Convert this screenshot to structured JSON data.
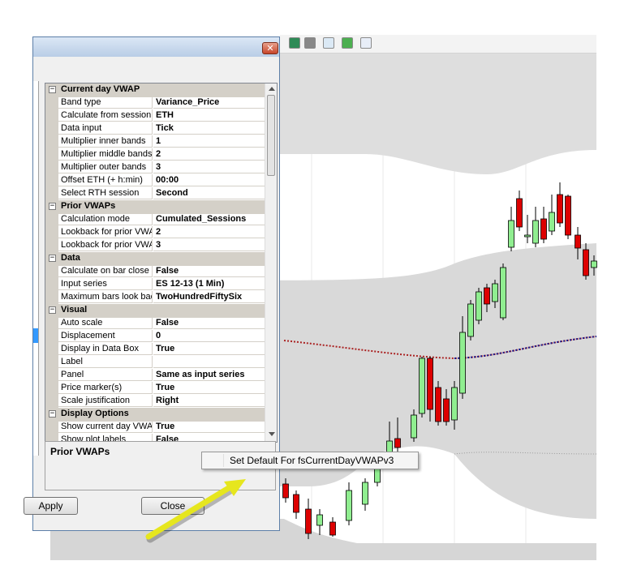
{
  "window": {
    "close_glyph": "✕"
  },
  "property_grid": {
    "sections": [
      {
        "title": "Current day VWAP",
        "props": [
          {
            "name": "Band type",
            "value": "Variance_Price"
          },
          {
            "name": "Calculate from session",
            "value": "ETH"
          },
          {
            "name": "Data input",
            "value": "Tick"
          },
          {
            "name": "Multiplier inner bands",
            "value": "1"
          },
          {
            "name": "Multiplier middle bands",
            "value": "2"
          },
          {
            "name": "Multiplier outer bands",
            "value": "3"
          },
          {
            "name": "Offset ETH (+ h:min)",
            "value": "00:00"
          },
          {
            "name": "Select RTH session",
            "value": "Second"
          }
        ]
      },
      {
        "title": "Prior VWAPs",
        "props": [
          {
            "name": "Calculation mode",
            "value": "Cumulated_Sessions"
          },
          {
            "name": "Lookback for prior VWA",
            "value": "2"
          },
          {
            "name": "Lookback for prior VWA",
            "value": "3"
          }
        ]
      },
      {
        "title": "Data",
        "props": [
          {
            "name": "Calculate on bar close",
            "value": "False"
          },
          {
            "name": "Input series",
            "value": "ES 12-13 (1 Min)"
          },
          {
            "name": "Maximum bars look bac",
            "value": "TwoHundredFiftySix"
          }
        ]
      },
      {
        "title": "Visual",
        "props": [
          {
            "name": "Auto scale",
            "value": "False"
          },
          {
            "name": "Displacement",
            "value": "0"
          },
          {
            "name": "Display in Data Box",
            "value": "True"
          },
          {
            "name": "Label",
            "value": ""
          },
          {
            "name": "Panel",
            "value": "Same as input series"
          },
          {
            "name": "Price marker(s)",
            "value": "True"
          },
          {
            "name": "Scale justification",
            "value": "Right"
          }
        ]
      },
      {
        "title": "Display Options",
        "props": [
          {
            "name": "Show current day VWA",
            "value": "True"
          },
          {
            "name": "Show plot labels",
            "value": "False"
          }
        ]
      }
    ]
  },
  "description": {
    "title": "Prior VWAPs"
  },
  "buttons": {
    "apply": "Apply",
    "close": "Close"
  },
  "context_menu": {
    "item": "Set Default For fsCurrentDayVWAPv3"
  },
  "colors": {
    "up_candle": "#90ee90",
    "down_candle": "#dd0000",
    "band_fill": "#dcdcdc",
    "prior_vwap": "#aa2222",
    "current_vwap": "#1a1a8c",
    "arrow": "#e6e61e"
  },
  "toolbar_icons": [
    "candlestick-icon",
    "bar-chart-icon",
    "line-chart-icon",
    "dollar-icon",
    "panel-icon"
  ]
}
